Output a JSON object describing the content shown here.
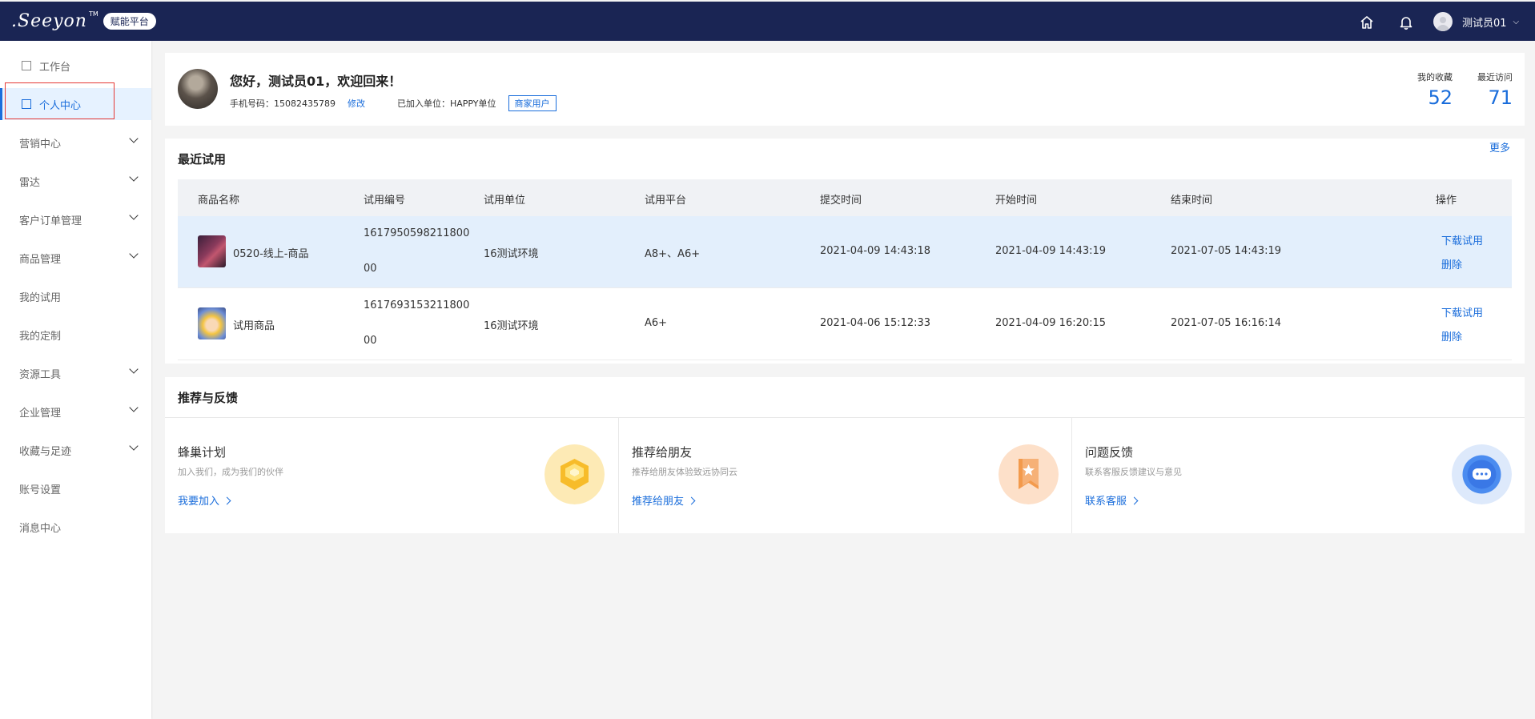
{
  "header": {
    "logo_text": ".Seeyon",
    "logo_tm": "TM",
    "badge": "赋能平台",
    "icons": [
      "home-icon",
      "bell-icon"
    ],
    "username": "测试员01"
  },
  "sidebar": {
    "items": [
      {
        "label": "工作台",
        "icon": "workbench-icon"
      },
      {
        "label": "个人中心",
        "icon": "user-center-icon"
      },
      {
        "label": "营销中心"
      },
      {
        "label": "雷达"
      },
      {
        "label": "客户订单管理"
      },
      {
        "label": "商品管理"
      },
      {
        "label": "我的试用"
      },
      {
        "label": "我的定制"
      },
      {
        "label": "资源工具"
      },
      {
        "label": "企业管理"
      },
      {
        "label": "收藏与足迹"
      },
      {
        "label": "账号设置"
      },
      {
        "label": "消息中心"
      }
    ]
  },
  "profile": {
    "greeting": "您好，测试员01，欢迎回来！",
    "phone_label": "手机号码：15082435789",
    "edit": "修改",
    "org_label": "已加入单位：HAPPY单位",
    "tag": "商家用户",
    "favorites_label": "我的收藏",
    "favorites_value": "52",
    "recent_label": "最近访问",
    "recent_value": "71"
  },
  "recent_trials": {
    "title": "最近试用",
    "more": "更多",
    "columns": [
      "商品名称",
      "试用编号",
      "试用单位",
      "试用平台",
      "提交时间",
      "开始时间",
      "结束时间",
      "操作"
    ],
    "rows": [
      {
        "name": "0520-线上-商品",
        "code_line1": "1617950598211800",
        "code_line2": "00",
        "unit": "16测试环境",
        "platform": "A8+、A6+",
        "submit": "2021-04-09 14:43:18",
        "start": "2021-04-09 14:43:19",
        "end": "2021-07-05 14:43:19",
        "download": "下载试用",
        "delete": "删除"
      },
      {
        "name": "试用商品",
        "code_line1": "1617693153211800",
        "code_line2": "00",
        "unit": "16测试环境",
        "platform": "A6+",
        "submit": "2021-04-06 15:12:33",
        "start": "2021-04-09 16:20:15",
        "end": "2021-07-05 16:16:14",
        "download": "下载试用",
        "delete": "删除"
      }
    ]
  },
  "recommend": {
    "title": "推荐与反馈",
    "cards": [
      {
        "title": "蜂巢计划",
        "sub": "加入我们，成为我们的伙伴",
        "link": "我要加入",
        "icon": "honeycomb-icon"
      },
      {
        "title": "推荐给朋友",
        "sub": "推荐给朋友体验致远协同云",
        "link": "推荐给朋友",
        "icon": "bookmark-star-icon"
      },
      {
        "title": "问题反馈",
        "sub": "联系客服反馈建议与意见",
        "link": "联系客服",
        "icon": "chat-bubble-icon"
      }
    ]
  },
  "colors": {
    "topbar": "#1a2554",
    "accent": "#1a6ddb",
    "highlight_row": "#e3effc",
    "active_outline": "#e53935"
  }
}
